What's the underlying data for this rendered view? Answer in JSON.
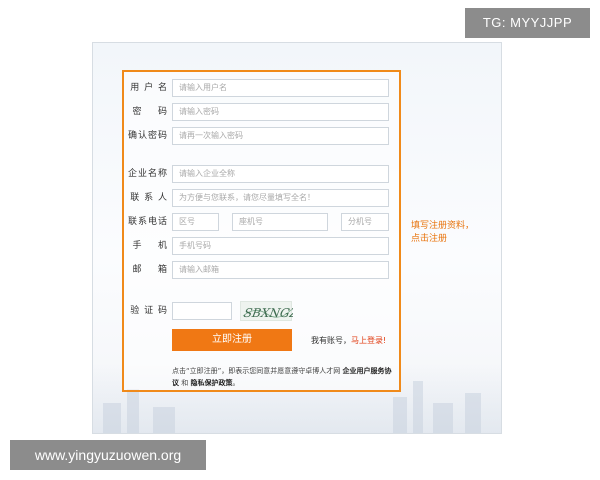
{
  "overlay": {
    "tg_badge": "TG: MYYJJPP",
    "watermark": "www.yingyuzuowen.org"
  },
  "form": {
    "fields": {
      "username": {
        "label": "用 户 名",
        "placeholder": "请输入用户名"
      },
      "password": {
        "label": "密    码",
        "placeholder": "请输入密码"
      },
      "confirm_password": {
        "label": "确认密码",
        "placeholder": "请再一次输入密码"
      },
      "company": {
        "label": "企业名称",
        "placeholder": "请输入企业全称"
      },
      "contact": {
        "label": "联 系 人",
        "placeholder": "为方便与您联系，请您尽量填写全名！"
      },
      "phone": {
        "label": "联系电话",
        "area_placeholder": "区号",
        "number_placeholder": "座机号",
        "ext_placeholder": "分机号"
      },
      "mobile": {
        "label": "手    机",
        "placeholder": "手机号码"
      },
      "email": {
        "label": "邮    箱",
        "placeholder": "请输入邮箱"
      },
      "captcha": {
        "label": "验 证 码",
        "value": "",
        "image_text": "SBXNGZ"
      }
    },
    "submit_label": "立即注册",
    "has_account_text": "我有账号，",
    "login_link": "马上登录",
    "login_suffix": "!",
    "agreement": {
      "prefix": "点击“立即注册”，即表示您同意并愿意遵守卓博人才网",
      "user_agreement": "企业用户服务协议",
      "and": " 和 ",
      "privacy_policy": "隐私保护政策",
      "suffix": "。"
    }
  },
  "side_note": {
    "line1": "填写注册资料，",
    "line2": "点击注册"
  },
  "colors": {
    "accent": "#f08a1a",
    "button": "#f07814",
    "link": "#e03a10"
  }
}
